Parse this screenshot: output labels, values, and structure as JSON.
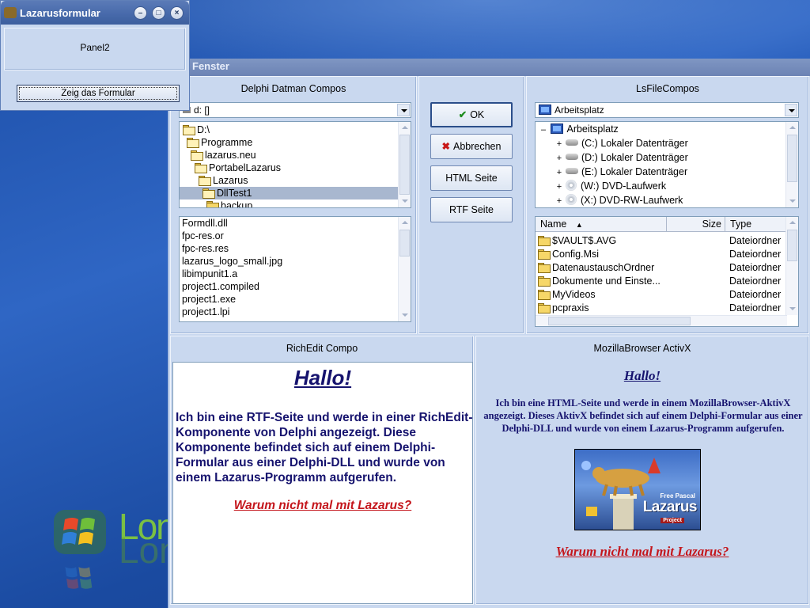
{
  "small_window": {
    "title": "Lazarusformular",
    "panel_label": "Panel2",
    "button_label": "Zeig das Formular",
    "minimize": "–",
    "maximize": "□",
    "close": "×"
  },
  "main_window": {
    "title": "Fenster"
  },
  "datman": {
    "caption": "Delphi Datman Compos",
    "drive_value": "d: []",
    "folders": [
      {
        "name": "D:\\",
        "indent": 0,
        "open": true,
        "selected": false
      },
      {
        "name": "Programme",
        "indent": 1,
        "open": true,
        "selected": false
      },
      {
        "name": "lazarus.neu",
        "indent": 2,
        "open": true,
        "selected": false
      },
      {
        "name": "PortabelLazarus",
        "indent": 3,
        "open": true,
        "selected": false
      },
      {
        "name": "Lazarus",
        "indent": 4,
        "open": true,
        "selected": false
      },
      {
        "name": "DllTest1",
        "indent": 5,
        "open": true,
        "selected": true
      },
      {
        "name": "backup",
        "indent": 6,
        "open": false,
        "selected": false
      }
    ],
    "files": [
      "Formdll.dll",
      "fpc-res.or",
      "fpc-res.res",
      "lazarus_logo_small.jpg",
      "libimpunit1.a",
      "project1.compiled",
      "project1.exe",
      "project1.lpi"
    ]
  },
  "buttons": {
    "ok": "OK",
    "cancel": "Abbrechen",
    "html": "HTML Seite",
    "rtf": "RTF Seite"
  },
  "lsfile": {
    "caption": "LsFileCompos",
    "combo_value": "Arbeitsplatz",
    "tree_root": "Arbeitsplatz",
    "tree_items": [
      {
        "drive": "(C:)",
        "label": "Lokaler Datenträger",
        "type": "hdd"
      },
      {
        "drive": "(D:)",
        "label": "Lokaler Datenträger",
        "type": "hdd"
      },
      {
        "drive": "(E:)",
        "label": "Lokaler Datenträger",
        "type": "hdd"
      },
      {
        "drive": "(W:)",
        "label": "DVD-Laufwerk",
        "type": "cd"
      },
      {
        "drive": "(X:)",
        "label": "DVD-RW-Laufwerk",
        "type": "cd"
      }
    ],
    "columns": {
      "name": "Name",
      "size": "Size",
      "type": "Type"
    },
    "rows": [
      {
        "name": "$VAULT$.AVG",
        "type": "Dateiordner"
      },
      {
        "name": "Config.Msi",
        "type": "Dateiordner"
      },
      {
        "name": "DatenaustauschOrdner",
        "type": "Dateiordner"
      },
      {
        "name": "Dokumente und Einste...",
        "type": "Dateiordner"
      },
      {
        "name": "MyVideos",
        "type": "Dateiordner"
      },
      {
        "name": "pcpraxis",
        "type": "Dateiordner"
      }
    ]
  },
  "richedit": {
    "caption": "RichEdit Compo",
    "heading": "Hallo!",
    "body": "Ich bin eine RTF-Seite und werde in einer RichEdit-Komponente von Delphi angezeigt. Diese Komponente befindet sich auf einem Delphi-Formular aus einer Delphi-DLL und wurde von einem Lazarus-Programm aufgerufen.",
    "link": "Warum nicht mal mit Lazarus?"
  },
  "mozilla": {
    "caption": "MozillaBrowser ActivX",
    "heading": "Hallo!",
    "body": "Ich bin eine HTML-Seite und werde in einem MozillaBrowser-AktivX angezeigt. Dieses AktivX befindet sich auf einem Delphi-Formular aus einer Delphi-DLL und wurde von einem Lazarus-Programm aufgerufen.",
    "logo_top": "Free Pascal",
    "logo_main": "Lazarus",
    "logo_tag": "Project",
    "link": "Warum nicht mal mit Lazarus?"
  },
  "desktop": {
    "wallpaper_text": "Long"
  },
  "colors": {
    "panel_bg": "#c9d8ef",
    "text_navy": "#16136e",
    "link_red": "#c4161c",
    "selection": "#a8b7cf"
  }
}
